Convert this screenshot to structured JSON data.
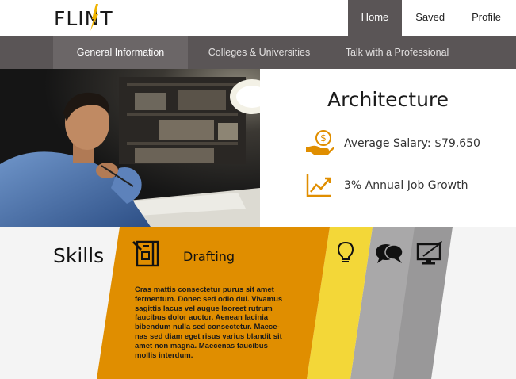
{
  "brand": {
    "logo_text": "FLINT",
    "accent_color": "#f0b400"
  },
  "top_nav": [
    {
      "label": "Home",
      "active": true
    },
    {
      "label": "Saved",
      "active": false
    },
    {
      "label": "Profile",
      "active": false
    }
  ],
  "sub_nav": [
    {
      "label": "General Information",
      "active": true
    },
    {
      "label": "Colleges & Universities",
      "active": false
    },
    {
      "label": "Talk with a Professional",
      "active": false
    }
  ],
  "career": {
    "title": "Architecture",
    "stats": [
      {
        "icon": "salary-icon",
        "text": "Average Salary: $79,650"
      },
      {
        "icon": "growth-chart-icon",
        "text": "3% Annual Job Growth"
      }
    ]
  },
  "skills": {
    "heading": "Skills",
    "active_skill": {
      "icon": "drafting-icon",
      "title": "Drafting",
      "description": "Cras mattis consectetur purus sit amet\nfermentum. Donec sed odio dui. Vivamus\nsagittis lacus vel augue laoreet rutrum\nfaucibus dolor auctor. Aenean lacinia\nbibendum nulla sed consectetur. Maece-\nnas sed diam eget risus varius blandit sit\namet non magna. Maecenas faucibus\nmollis interdum."
    },
    "tabs": [
      {
        "icon": "lightbulb-icon",
        "color": "#f3d738"
      },
      {
        "icon": "speech-bubbles-icon",
        "color": "#a9a8a9"
      },
      {
        "icon": "computer-icon",
        "color": "#999899"
      }
    ],
    "colors": {
      "active_panel": "#e08e00",
      "background": "#f4f4f4"
    }
  }
}
